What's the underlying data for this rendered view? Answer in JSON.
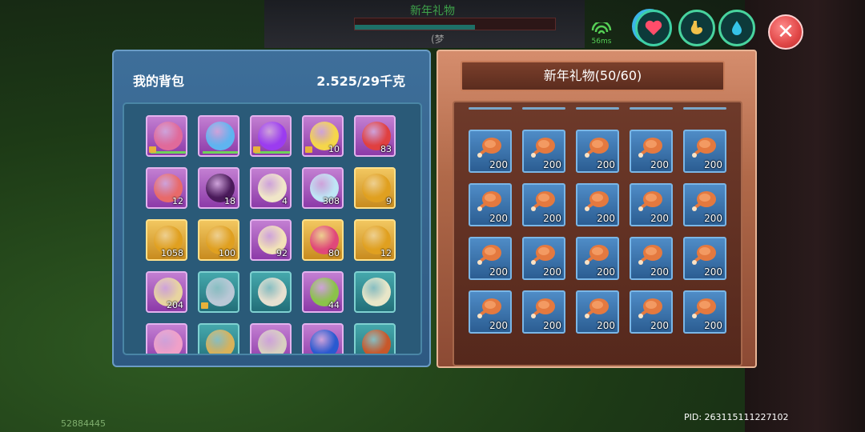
{
  "hud": {
    "event_title": "新年礼物",
    "target_name": "(梦",
    "health_fraction": 0.6,
    "ping_text": "56ms",
    "stats": [
      {
        "name": "heart",
        "color": "#ff4d6a"
      },
      {
        "name": "stomach",
        "color": "#f2c14a"
      },
      {
        "name": "water-drop",
        "color": "#35c3e8"
      }
    ],
    "close_icon": "close-icon"
  },
  "backpack": {
    "title": "我的背包",
    "weight": "2.525/29千克",
    "items": [
      {
        "icon": "lollipop-icon",
        "count": "",
        "rarity": "purple",
        "locked": true,
        "durability": true,
        "color": "#e06a9a"
      },
      {
        "icon": "crystal-potion-icon",
        "count": "",
        "rarity": "purple",
        "locked": false,
        "durability": true,
        "color": "#5fb4f0"
      },
      {
        "icon": "purple-gem-amulet-icon",
        "count": "",
        "rarity": "purple",
        "locked": true,
        "durability": true,
        "color": "#9b3cf0"
      },
      {
        "icon": "yellow-shirt-icon",
        "count": "10",
        "rarity": "purple",
        "locked": true,
        "durability": false,
        "color": "#f5d64a"
      },
      {
        "icon": "maple-leaf-card-icon",
        "count": "83",
        "rarity": "purple",
        "locked": false,
        "durability": false,
        "color": "#e04040"
      },
      {
        "icon": "red-ticket-icon",
        "count": "12",
        "rarity": "purple",
        "locked": false,
        "durability": false,
        "color": "#e86a6a"
      },
      {
        "icon": "dark-flag-icon",
        "count": "18",
        "rarity": "purple",
        "locked": false,
        "durability": false,
        "color": "#4a1a5a"
      },
      {
        "icon": "scroll-icon",
        "count": "4",
        "rarity": "purple",
        "locked": false,
        "durability": false,
        "color": "#f0e6c8"
      },
      {
        "icon": "snow-card-icon",
        "count": "308",
        "rarity": "purple",
        "locked": false,
        "durability": false,
        "color": "#bfe6f5"
      },
      {
        "icon": "gold-coin-icon",
        "count": "9",
        "rarity": "gold",
        "locked": false,
        "durability": false,
        "color": "#e0a020"
      },
      {
        "icon": "gold-bow-coin-icon",
        "count": "1058",
        "rarity": "gold",
        "locked": false,
        "durability": false,
        "color": "#e0a020"
      },
      {
        "icon": "gold-coin-icon",
        "count": "100",
        "rarity": "gold",
        "locked": false,
        "durability": false,
        "color": "#e0a020"
      },
      {
        "icon": "wanted-poster-icon",
        "count": "92",
        "rarity": "purple",
        "locked": false,
        "durability": false,
        "color": "#f2e2b8"
      },
      {
        "icon": "flower-badge-icon",
        "count": "80",
        "rarity": "gold",
        "locked": false,
        "durability": false,
        "color": "#e0487a"
      },
      {
        "icon": "gold-coin-icon",
        "count": "12",
        "rarity": "gold",
        "locked": false,
        "durability": false,
        "color": "#e0a020"
      },
      {
        "icon": "wanted-poster-icon",
        "count": "204",
        "rarity": "purple",
        "locked": false,
        "durability": false,
        "color": "#e8d4a0"
      },
      {
        "icon": "stone-disc-icon",
        "count": "",
        "rarity": "teal",
        "locked": true,
        "durability": false,
        "color": "#b9c8d6"
      },
      {
        "icon": "horn-icon",
        "count": "",
        "rarity": "teal",
        "locked": false,
        "durability": false,
        "color": "#e6e0d0"
      },
      {
        "icon": "robot-pet-icon",
        "count": "44",
        "rarity": "purple",
        "locked": false,
        "durability": false,
        "color": "#8bc34a"
      },
      {
        "icon": "dice-box-icon",
        "count": "",
        "rarity": "teal",
        "locked": false,
        "durability": false,
        "color": "#e8e6c8"
      },
      {
        "icon": "pink-cat-icon",
        "count": "",
        "rarity": "purple",
        "locked": false,
        "durability": false,
        "color": "#f0a0c8"
      },
      {
        "icon": "gold-trophy-icon",
        "count": "",
        "rarity": "teal",
        "locked": false,
        "durability": false,
        "color": "#d8b25a"
      },
      {
        "icon": "shell-icon",
        "count": "",
        "rarity": "purple",
        "locked": false,
        "durability": false,
        "color": "#d8d0c0"
      },
      {
        "icon": "blue-hat-icon",
        "count": "",
        "rarity": "purple",
        "locked": false,
        "durability": false,
        "color": "#2a5ad0"
      },
      {
        "icon": "treasure-chest-icon",
        "count": "",
        "rarity": "teal",
        "locked": false,
        "durability": false,
        "color": "#c8582a"
      }
    ]
  },
  "gift_box": {
    "title": "新年礼物(50/60)",
    "items": [
      {
        "icon": "roast-chicken-leg-icon",
        "count": "200"
      },
      {
        "icon": "roast-chicken-leg-icon",
        "count": "200"
      },
      {
        "icon": "roast-chicken-leg-icon",
        "count": "200"
      },
      {
        "icon": "roast-chicken-leg-icon",
        "count": "200"
      },
      {
        "icon": "roast-chicken-leg-icon",
        "count": "200"
      },
      {
        "icon": "roast-chicken-leg-icon",
        "count": "200"
      },
      {
        "icon": "roast-chicken-leg-icon",
        "count": "200"
      },
      {
        "icon": "roast-chicken-leg-icon",
        "count": "200"
      },
      {
        "icon": "roast-chicken-leg-icon",
        "count": "200"
      },
      {
        "icon": "roast-chicken-leg-icon",
        "count": "200"
      },
      {
        "icon": "roast-chicken-leg-icon",
        "count": "200"
      },
      {
        "icon": "roast-chicken-leg-icon",
        "count": "200"
      },
      {
        "icon": "roast-chicken-leg-icon",
        "count": "200"
      },
      {
        "icon": "roast-chicken-leg-icon",
        "count": "200"
      },
      {
        "icon": "roast-chicken-leg-icon",
        "count": "200"
      },
      {
        "icon": "roast-chicken-leg-icon",
        "count": "200"
      },
      {
        "icon": "roast-chicken-leg-icon",
        "count": "200"
      },
      {
        "icon": "roast-chicken-leg-icon",
        "count": "200"
      },
      {
        "icon": "roast-chicken-leg-icon",
        "count": "200"
      },
      {
        "icon": "roast-chicken-leg-icon",
        "count": "200"
      }
    ]
  },
  "footer": {
    "uid": "52884445",
    "pid": "PID: 263115111227102"
  }
}
